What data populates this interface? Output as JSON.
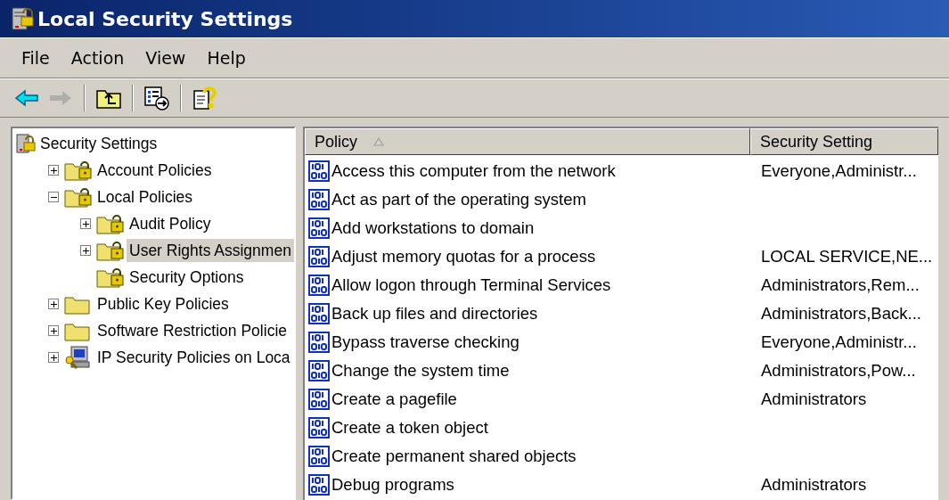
{
  "window": {
    "title": "Local Security Settings"
  },
  "menu": [
    "File",
    "Action",
    "View",
    "Help"
  ],
  "toolbar": [
    {
      "kind": "back",
      "disabled": false
    },
    {
      "kind": "forward",
      "disabled": true
    },
    {
      "kind": "separator"
    },
    {
      "kind": "up"
    },
    {
      "kind": "separator"
    },
    {
      "kind": "export"
    },
    {
      "kind": "separator"
    },
    {
      "kind": "help"
    }
  ],
  "tree": [
    {
      "label": "Security Settings",
      "kind": "root",
      "selected": false,
      "children": [
        {
          "label": "Account Policies",
          "kind": "lock-folder",
          "expanded": false,
          "selected": false
        },
        {
          "label": "Local Policies",
          "kind": "lock-folder",
          "expanded": true,
          "selected": false,
          "children": [
            {
              "label": "Audit Policy",
              "kind": "lock-folder",
              "expanded": false,
              "selected": false
            },
            {
              "label": "User Rights Assignmen",
              "kind": "lock-folder",
              "expanded": false,
              "selected": true
            },
            {
              "label": "Security Options",
              "kind": "lock-folder",
              "selected": false
            }
          ]
        },
        {
          "label": "Public Key Policies",
          "kind": "folder",
          "expanded": false,
          "selected": false
        },
        {
          "label": "Software Restriction Policie",
          "kind": "folder",
          "expanded": false,
          "selected": false
        },
        {
          "label": "IP Security Policies on Loca",
          "kind": "ip-security",
          "expanded": false,
          "selected": false
        }
      ]
    }
  ],
  "table": {
    "columns": [
      {
        "label": "Policy",
        "sorted": true
      },
      {
        "label": "Security Setting",
        "sorted": false
      }
    ],
    "rows": [
      {
        "policy": "Access this computer from the network",
        "setting": "Everyone,Administr..."
      },
      {
        "policy": "Act as part of the operating system",
        "setting": ""
      },
      {
        "policy": "Add workstations to domain",
        "setting": ""
      },
      {
        "policy": "Adjust memory quotas for a process",
        "setting": "LOCAL SERVICE,NE..."
      },
      {
        "policy": "Allow logon through Terminal Services",
        "setting": "Administrators,Rem..."
      },
      {
        "policy": "Back up files and directories",
        "setting": "Administrators,Back..."
      },
      {
        "policy": "Bypass traverse checking",
        "setting": "Everyone,Administr..."
      },
      {
        "policy": "Change the system time",
        "setting": "Administrators,Pow..."
      },
      {
        "policy": "Create a pagefile",
        "setting": "Administrators"
      },
      {
        "policy": "Create a token object",
        "setting": ""
      },
      {
        "policy": "Create permanent shared objects",
        "setting": ""
      },
      {
        "policy": "Debug programs",
        "setting": "Administrators"
      }
    ]
  }
}
